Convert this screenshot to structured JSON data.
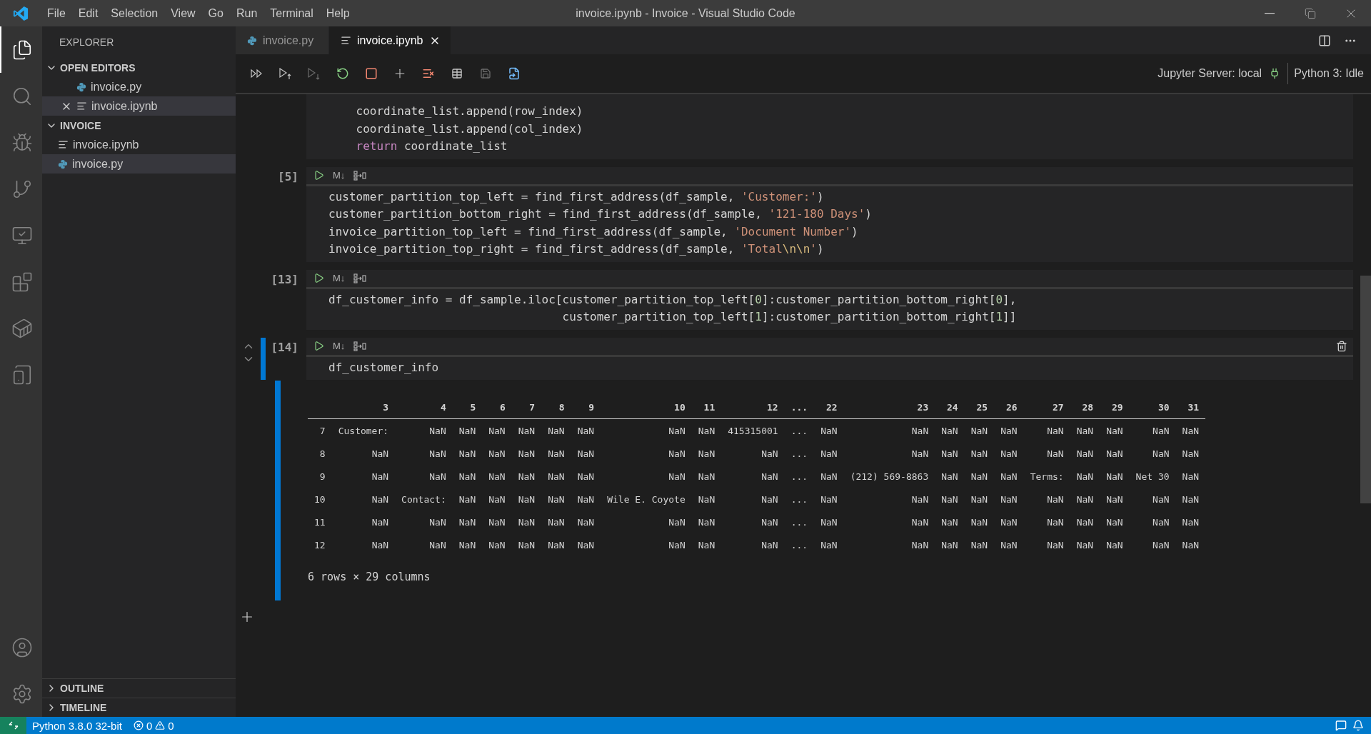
{
  "window": {
    "title": "invoice.ipynb - Invoice - Visual Studio Code"
  },
  "menu": [
    "File",
    "Edit",
    "Selection",
    "View",
    "Go",
    "Run",
    "Terminal",
    "Help"
  ],
  "activity_bar": [
    {
      "kind": "files",
      "selected": true
    },
    {
      "kind": "search",
      "selected": false
    },
    {
      "kind": "debug",
      "selected": false
    },
    {
      "kind": "git",
      "selected": false
    },
    {
      "kind": "remote",
      "selected": false
    },
    {
      "kind": "extensions",
      "selected": false
    },
    {
      "kind": "docker",
      "selected": false
    },
    {
      "kind": "notebook",
      "selected": false
    }
  ],
  "sidebar": {
    "title": "EXPLORER",
    "sections": [
      {
        "label": "OPEN EDITORS",
        "expanded": true,
        "items": [
          {
            "label": "invoice.py",
            "kind": "python",
            "selected": false,
            "close_shown": false
          },
          {
            "label": "invoice.ipynb",
            "kind": "notebook",
            "selected": true,
            "close_shown": true
          }
        ]
      },
      {
        "label": "INVOICE",
        "expanded": true,
        "items": [
          {
            "label": "invoice.ipynb",
            "kind": "notebook",
            "selected": false,
            "close_shown": false
          },
          {
            "label": "invoice.py",
            "kind": "python",
            "selected": true,
            "close_shown": false
          }
        ]
      }
    ],
    "bottom_sections": [
      {
        "label": "OUTLINE",
        "expanded": false
      },
      {
        "label": "TIMELINE",
        "expanded": false
      }
    ]
  },
  "tabs": [
    {
      "label": "invoice.py",
      "kind": "python",
      "selected": false
    },
    {
      "label": "invoice.ipynb",
      "kind": "notebook",
      "selected": true
    }
  ],
  "toolbar": {
    "server": "Jupyter Server: local",
    "kernel": "Python 3: Idle"
  },
  "cells": [
    {
      "selected": false,
      "lines": [
        [
          {
            "kind": "plain",
            "text": "    coordinate_list.append(row_index)"
          }
        ],
        [
          {
            "kind": "plain",
            "text": "    coordinate_list.append(col_index)"
          }
        ],
        [
          {
            "kind": "keyword",
            "text": "    return"
          },
          {
            "kind": "plain",
            "text": " coordinate_list"
          }
        ]
      ]
    },
    {
      "selected": false,
      "header": {
        "prompt": "[5]",
        "markdown_label": "M↓"
      },
      "lines": [
        [
          {
            "kind": "plain",
            "text": "customer_partition_top_left = find_first_address(df_sample, "
          },
          {
            "kind": "string",
            "text": "'Customer:'"
          },
          {
            "kind": "plain",
            "text": ")"
          }
        ],
        [
          {
            "kind": "plain",
            "text": "customer_partition_bottom_right = find_first_address(df_sample, "
          },
          {
            "kind": "string",
            "text": "'121-180 Days'"
          },
          {
            "kind": "plain",
            "text": ")"
          }
        ],
        [
          {
            "kind": "plain",
            "text": "invoice_partition_top_left = find_first_address(df_sample, "
          },
          {
            "kind": "string",
            "text": "'Document Number'"
          },
          {
            "kind": "plain",
            "text": ")"
          }
        ],
        [
          {
            "kind": "plain",
            "text": "invoice_partition_top_right = find_first_address(df_sample, "
          },
          {
            "kind": "string",
            "text": "'Total"
          },
          {
            "kind": "escape",
            "text": "\\n\\n"
          },
          {
            "kind": "string",
            "text": "'"
          },
          {
            "kind": "plain",
            "text": ")"
          }
        ]
      ]
    },
    {
      "selected": false,
      "header": {
        "prompt": "[13]",
        "markdown_label": "M↓"
      },
      "lines": [
        [
          {
            "kind": "plain",
            "text": "df_customer_info = df_sample.iloc[customer_partition_top_left["
          },
          {
            "kind": "number",
            "text": "0"
          },
          {
            "kind": "plain",
            "text": "]:customer_partition_bottom_right["
          },
          {
            "kind": "number",
            "text": "0"
          },
          {
            "kind": "plain",
            "text": "],"
          }
        ],
        [
          {
            "kind": "plain",
            "text": "                                  customer_partition_top_left["
          },
          {
            "kind": "number",
            "text": "1"
          },
          {
            "kind": "plain",
            "text": "]:customer_partition_bottom_right["
          },
          {
            "kind": "number",
            "text": "1"
          },
          {
            "kind": "plain",
            "text": "]]"
          }
        ]
      ]
    },
    {
      "selected": true,
      "header": {
        "prompt": "[14]",
        "markdown_label": "M↓"
      },
      "lines": [
        [
          {
            "kind": "plain",
            "text": "df_customer_info"
          }
        ]
      ],
      "output": {
        "columns": [
          "3",
          "4",
          "5",
          "6",
          "7",
          "8",
          "9",
          "10",
          "11",
          "12",
          "...",
          "22",
          "23",
          "24",
          "25",
          "26",
          "27",
          "28",
          "29",
          "30",
          "31"
        ],
        "rows": [
          {
            "index": "7",
            "cells": [
              "Customer:",
              "NaN",
              "NaN",
              "NaN",
              "NaN",
              "NaN",
              "NaN",
              "NaN",
              "NaN",
              "415315001",
              "...",
              "NaN",
              "NaN",
              "NaN",
              "NaN",
              "NaN",
              "NaN",
              "NaN",
              "NaN",
              "NaN",
              "NaN"
            ]
          },
          {
            "index": "8",
            "cells": [
              "NaN",
              "NaN",
              "NaN",
              "NaN",
              "NaN",
              "NaN",
              "NaN",
              "NaN",
              "NaN",
              "NaN",
              "...",
              "NaN",
              "NaN",
              "NaN",
              "NaN",
              "NaN",
              "NaN",
              "NaN",
              "NaN",
              "NaN",
              "NaN"
            ]
          },
          {
            "index": "9",
            "cells": [
              "NaN",
              "NaN",
              "NaN",
              "NaN",
              "NaN",
              "NaN",
              "NaN",
              "NaN",
              "NaN",
              "NaN",
              "...",
              "NaN",
              "(212) 569-8863",
              "NaN",
              "NaN",
              "NaN",
              "Terms:",
              "NaN",
              "NaN",
              "Net 30",
              "NaN"
            ]
          },
          {
            "index": "10",
            "cells": [
              "NaN",
              "Contact:",
              "NaN",
              "NaN",
              "NaN",
              "NaN",
              "NaN",
              "Wile E. Coyote",
              "NaN",
              "NaN",
              "...",
              "NaN",
              "NaN",
              "NaN",
              "NaN",
              "NaN",
              "NaN",
              "NaN",
              "NaN",
              "NaN",
              "NaN"
            ]
          },
          {
            "index": "11",
            "cells": [
              "NaN",
              "NaN",
              "NaN",
              "NaN",
              "NaN",
              "NaN",
              "NaN",
              "NaN",
              "NaN",
              "NaN",
              "...",
              "NaN",
              "NaN",
              "NaN",
              "NaN",
              "NaN",
              "NaN",
              "NaN",
              "NaN",
              "NaN",
              "NaN"
            ]
          },
          {
            "index": "12",
            "cells": [
              "NaN",
              "NaN",
              "NaN",
              "NaN",
              "NaN",
              "NaN",
              "NaN",
              "NaN",
              "NaN",
              "NaN",
              "...",
              "NaN",
              "NaN",
              "NaN",
              "NaN",
              "NaN",
              "NaN",
              "NaN",
              "NaN",
              "NaN",
              "NaN"
            ]
          }
        ],
        "summary": "6 rows × 29 columns"
      }
    }
  ],
  "status_bar": {
    "interpreter": "Python 3.8.0 32-bit",
    "errors": "0",
    "warnings": "0"
  }
}
